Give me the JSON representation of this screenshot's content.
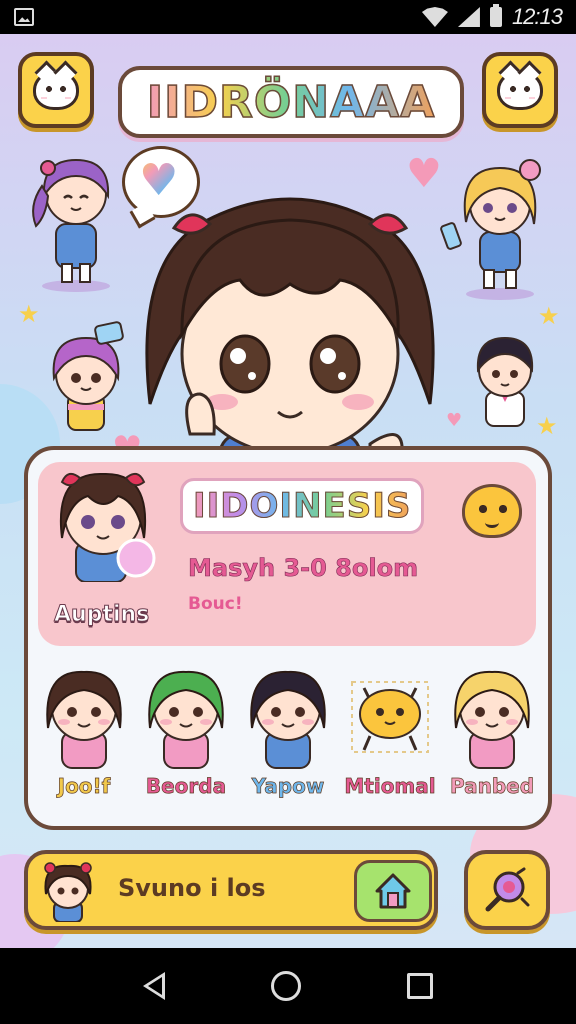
{
  "status_bar": {
    "time": "12:13",
    "icons": [
      "gallery-icon",
      "wifi-icon",
      "signal-icon",
      "battery-icon"
    ]
  },
  "header": {
    "logo_text": "IIDRÖNAAA",
    "left_button_icon": "cat-face-icon",
    "right_button_icon": "cat-face-icon"
  },
  "profile": {
    "title": "IIDOINESIS",
    "line1": "Masyh 3-0 8olom",
    "line2": "Bouc!",
    "avatar_label": "Auptins"
  },
  "characters": [
    {
      "name": "Joo!f",
      "color": "#f2c94c",
      "hair": "#4a2c23",
      "outfit": "#f29bc3"
    },
    {
      "name": "Beorda",
      "color": "#e55a93",
      "hair": "#4caf50",
      "outfit": "#f29bc3"
    },
    {
      "name": "Yapow",
      "color": "#6fb7ec",
      "hair": "#2b2233",
      "outfit": "#5b8fd6"
    },
    {
      "name": "Mtiomal",
      "color": "#e55a93",
      "hair": "#fbc53d",
      "outfit": "#fbc53d"
    },
    {
      "name": "Panbed",
      "color": "#f29bb8",
      "hair": "#f6d36b",
      "outfit": "#f29bc3"
    }
  ],
  "bottom_bar": {
    "label": "Svuno i los",
    "home_icon": "home-icon",
    "search_icon": "search-icon"
  },
  "colors": {
    "accent_yellow": "#fbd24a",
    "outline_brown": "#6b4a3a",
    "pink_card": "#f8c6cc",
    "green_button": "#a6e36d"
  }
}
